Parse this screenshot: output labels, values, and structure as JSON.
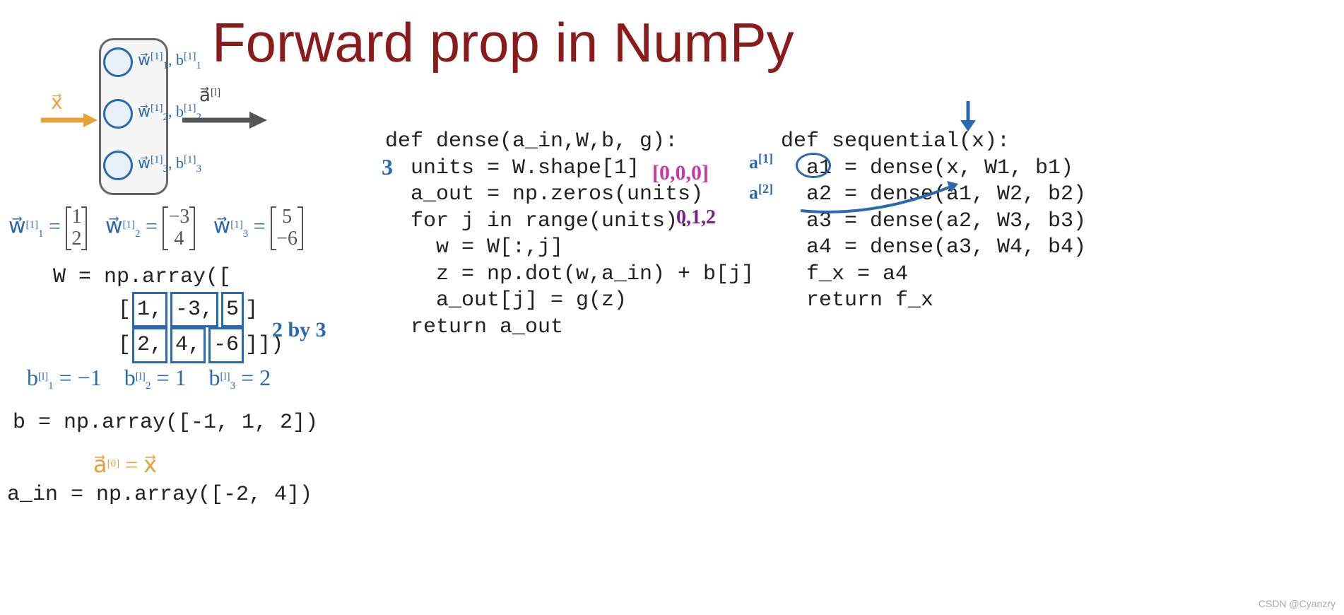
{
  "title": "Forward prop in NumPy",
  "diagram": {
    "input_label": "x⃗",
    "output_label": "a⃗",
    "output_sup": "[l]",
    "neurons": {
      "n1": "w⃗₁⁽¹⁾, b₁⁽¹⁾",
      "n2": "w⃗₂⁽¹⁾, b₂⁽¹⁾",
      "n3": "w⃗₃⁽¹⁾, b₃⁽¹⁾"
    }
  },
  "weights": {
    "w1_label": "w⃗₁⁽¹⁾ =",
    "w1_vals": [
      "1",
      "2"
    ],
    "w2_label": "w⃗₂⁽¹⁾ =",
    "w2_vals": [
      "−3",
      "4"
    ],
    "w3_label": "w⃗₃⁽¹⁾ =",
    "w3_vals": [
      "5",
      "−6"
    ]
  },
  "W_code": {
    "l1": "W = np.array([",
    "l2a": "[",
    "l2_v1": "1,",
    "l2_v2": "-3,",
    "l2_v3": "5",
    "l2b": "]",
    "l3a": "[",
    "l3_v1": "2,",
    "l3_v2": "4,",
    "l3_v3": "-6",
    "l3b": "]])"
  },
  "ann_2by3": "2 by 3",
  "b_math": "b₁⁽ˡ⁾ = −1    b₂⁽ˡ⁾ = 1    b₃⁽ˡ⁾ = 2",
  "b_code": "b = np.array([-1, 1, 2])",
  "a0_math": "a⃗⁽⁰⁾ = x⃗",
  "ain_code": "a_in = np.array([-2, 4])",
  "dense": {
    "l1": "def dense(a_in,W,b, g):",
    "l2": "units = W.shape[1]",
    "l3": "a_out = np.zeros(units)",
    "l4": "for j in range(units):",
    "l5": "w = W[:,j]",
    "l6": "z = np.dot(w,a_in) + b[j]",
    "l7": "a_out[j] = g(z)",
    "l8": "return a_out"
  },
  "sequential": {
    "l1": "def sequential(x):",
    "l2": "a1 = dense(x, W1, b1)",
    "l3": "a2 = dense(a1, W2, b2)",
    "l4": "a3 = dense(a2, W3, b3)",
    "l5": "a4 = dense(a3, W4, b4)",
    "l6": "f_x = a4",
    "l7": "return f_x"
  },
  "ann_3": "3",
  "ann_000": "[0,0,0]",
  "ann_012": "0,1,2",
  "ann_a1": "a⁽¹⁾",
  "ann_a2": "a⁽²⁾",
  "watermark": "CSDN @Cyanzry"
}
